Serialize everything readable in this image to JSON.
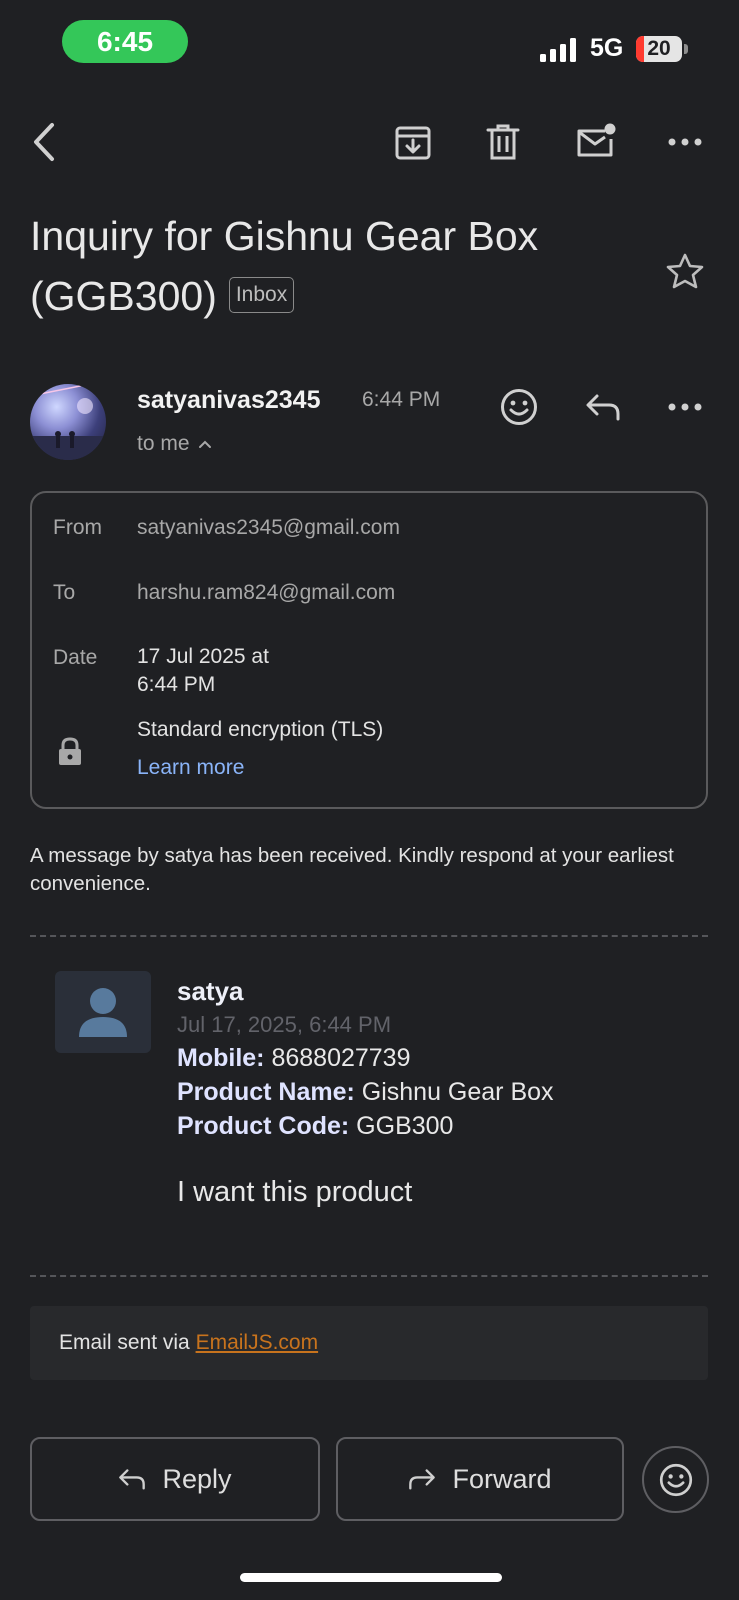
{
  "status_bar": {
    "time": "6:45",
    "network": "5G",
    "battery": "20"
  },
  "toolbar": {
    "icons": [
      "back-arrow-icon",
      "archive-icon",
      "trash-icon",
      "mark-unread-icon",
      "more-icon"
    ]
  },
  "email": {
    "subject": "Inquiry for Gishnu Gear Box (GGB300)",
    "label_chip": "Inbox",
    "sender": {
      "name": "satyanivas2345",
      "time": "6:44 PM",
      "recipient_summary": "to me"
    },
    "details": {
      "from_label": "From",
      "from_value": "satyanivas2345@gmail.com",
      "to_label": "To",
      "to_value": "harshu.ram824@gmail.com",
      "date_label": "Date",
      "date_line1": "17 Jul 2025 at",
      "date_line2": "6:44 PM",
      "encryption": "Standard encryption (TLS)",
      "learn_more": "Learn more"
    },
    "body_intro": "A message by satya has been received. Kindly respond at your earliest convenience.",
    "card": {
      "name": "satya",
      "date": "Jul 17, 2025, 6:44 PM",
      "mobile_label": "Mobile:",
      "mobile_value": "8688027739",
      "product_name_label": "Product Name:",
      "product_name_value": "Gishnu Gear Box",
      "product_code_label": "Product Code:",
      "product_code_value": "GGB300",
      "message": "I want this product"
    },
    "footer": {
      "prefix": "Email sent via",
      "link": "EmailJS.com"
    }
  },
  "actions": {
    "reply": "Reply",
    "forward": "Forward"
  },
  "colors": {
    "background": "#1f2023",
    "link": "#8ab4f8",
    "footer_link": "#c8731d",
    "time_pill": "#34c759",
    "battery_low": "#ff3b30"
  }
}
